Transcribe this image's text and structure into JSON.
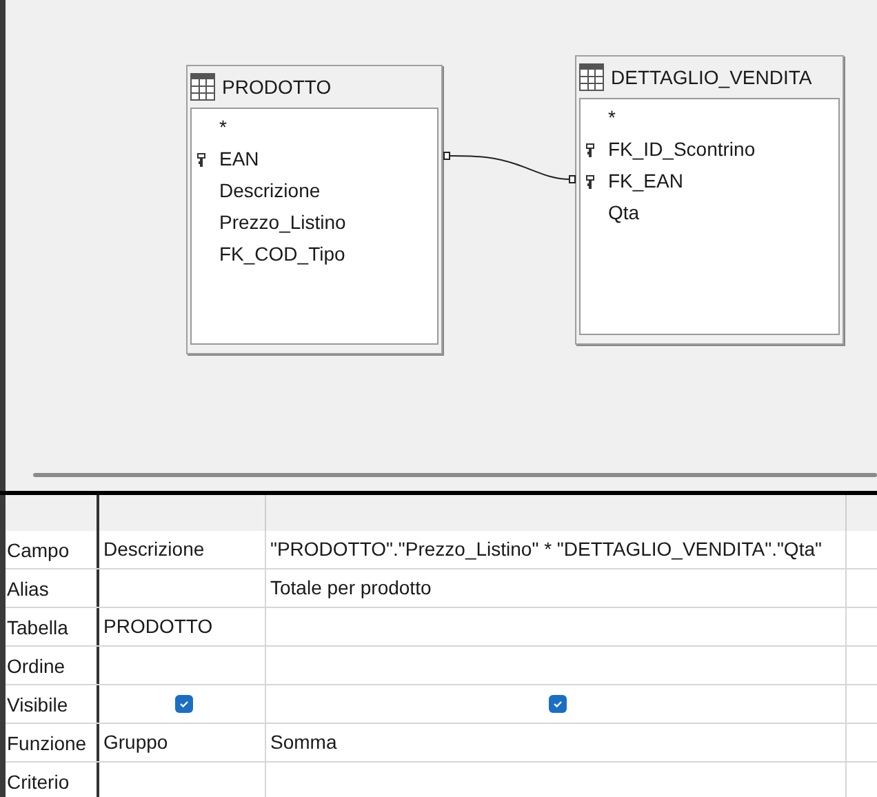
{
  "tables": [
    {
      "name": "PRODOTTO",
      "fields": [
        {
          "name": "*",
          "primary_key": false
        },
        {
          "name": "EAN",
          "primary_key": true
        },
        {
          "name": "Descrizione",
          "primary_key": false
        },
        {
          "name": "Prezzo_Listino",
          "primary_key": false
        },
        {
          "name": "FK_COD_Tipo",
          "primary_key": false
        }
      ]
    },
    {
      "name": "DETTAGLIO_VENDITA",
      "fields": [
        {
          "name": "*",
          "primary_key": false
        },
        {
          "name": "FK_ID_Scontrino",
          "primary_key": true
        },
        {
          "name": "FK_EAN",
          "primary_key": true
        },
        {
          "name": "Qta",
          "primary_key": false
        }
      ]
    }
  ],
  "grid": {
    "rows": [
      {
        "label": "Campo",
        "kind": "text",
        "cells": [
          "Descrizione",
          "\"PRODOTTO\".\"Prezzo_Listino\" * \"DETTAGLIO_VENDITA\".\"Qta\""
        ]
      },
      {
        "label": "Alias",
        "kind": "text",
        "cells": [
          null,
          "Totale per prodotto"
        ]
      },
      {
        "label": "Tabella",
        "kind": "text",
        "cells": [
          "PRODOTTO",
          null
        ]
      },
      {
        "label": "Ordine",
        "kind": "text",
        "cells": [
          null,
          null
        ]
      },
      {
        "label": "Visibile",
        "kind": "checkbox",
        "checked": [
          true,
          true
        ]
      },
      {
        "label": "Funzione",
        "kind": "text",
        "cells": [
          "Gruppo",
          "Somma"
        ]
      },
      {
        "label": "Criterio",
        "kind": "text",
        "cells": [
          null,
          null
        ]
      }
    ]
  }
}
